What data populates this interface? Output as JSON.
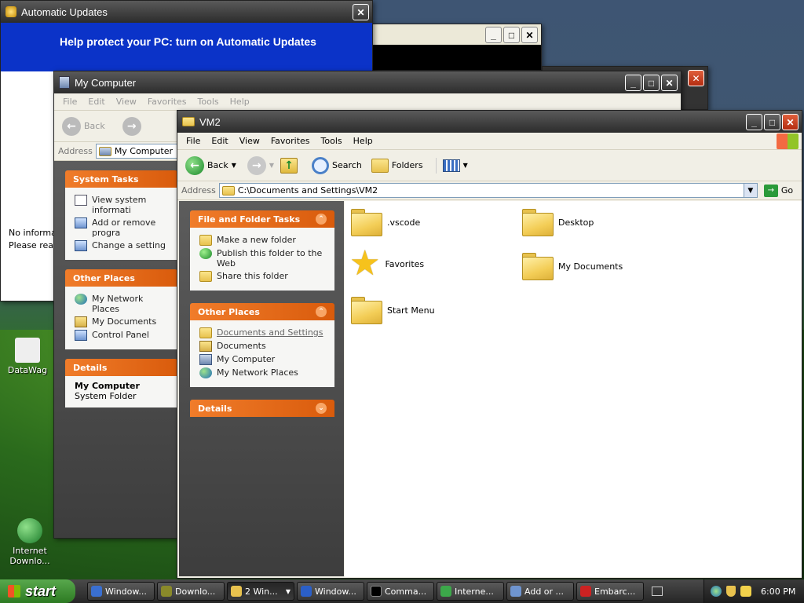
{
  "desktop": {
    "icons": [
      {
        "label": "DataWag"
      },
      {
        "label": "Internet Downlo..."
      }
    ]
  },
  "auto_updates": {
    "title": "Automatic Updates",
    "heading": "Help protect your PC: turn on Automatic Updates",
    "body_line1": "No informat",
    "body_line2": "Please read"
  },
  "my_computer": {
    "title": "My Computer",
    "menu": [
      "File",
      "Edit",
      "View",
      "Favorites",
      "Tools",
      "Help"
    ],
    "back": "Back",
    "address_label": "Address",
    "address_value": "My Computer",
    "system_tasks": {
      "header": "System Tasks",
      "items": [
        "View system informati",
        "Add or remove progra",
        "Change a setting"
      ]
    },
    "other_places": {
      "header": "Other Places",
      "items": [
        "My Network Places",
        "My Documents",
        "Control Panel"
      ]
    },
    "details": {
      "header": "Details",
      "name": "My Computer",
      "type": "System Folder"
    }
  },
  "vm2": {
    "title": "VM2",
    "menu": [
      "File",
      "Edit",
      "View",
      "Favorites",
      "Tools",
      "Help"
    ],
    "toolbar": {
      "back": "Back",
      "search": "Search",
      "folders": "Folders"
    },
    "address_label": "Address",
    "address_value": "C:\\Documents and Settings\\VM2",
    "go": "Go",
    "file_tasks": {
      "header": "File and Folder Tasks",
      "items": [
        "Make a new folder",
        "Publish this folder to the Web",
        "Share this folder"
      ]
    },
    "other_places": {
      "header": "Other Places",
      "items": [
        "Documents and Settings",
        "Documents",
        "My Computer",
        "My Network Places"
      ]
    },
    "details": {
      "header": "Details"
    },
    "files": [
      {
        "name": ".vscode",
        "icon": "folder"
      },
      {
        "name": "Desktop",
        "icon": "folder"
      },
      {
        "name": "Favorites",
        "icon": "star"
      },
      {
        "name": "My Documents",
        "icon": "folder"
      },
      {
        "name": "Start Menu",
        "icon": "folder"
      }
    ]
  },
  "taskbar": {
    "start": "start",
    "tasks": [
      "Window...",
      "Downlo...",
      "2 Win...",
      "Window...",
      "Comma...",
      "Interne...",
      "Add or ...",
      "Embarc..."
    ],
    "clock": "6:00 PM"
  }
}
